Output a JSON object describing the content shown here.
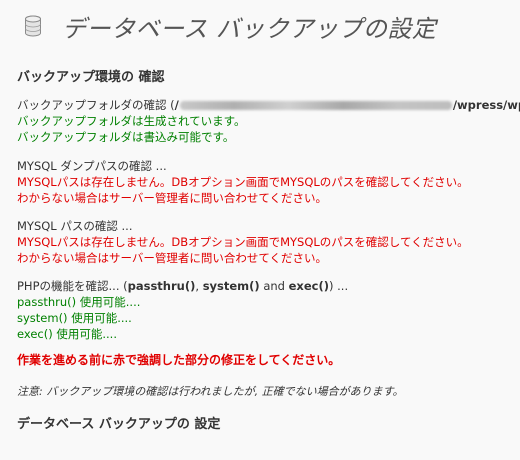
{
  "header": {
    "title": "データベース バックアップの設定",
    "icon": "database-icon"
  },
  "check_section": {
    "heading": "バックアップ環境の 確認"
  },
  "folder_check": {
    "label_prefix": "バックアップフォルダの確認 (",
    "path_start": "/",
    "path_end": "/wpress/wp-",
    "created": "バックアップフォルダは生成されています。",
    "writable": "バックアップフォルダは書込み可能です。"
  },
  "mysqldump_check": {
    "label": "MYSQL ダンプパスの確認 ...",
    "error_line1": "MYSQLパスは存在しません。DBオプション画面でMYSQLのパスを確認してください。",
    "error_line2": "わからない場合はサーバー管理者に問い合わせてください。"
  },
  "mysql_check": {
    "label": "MYSQL パスの確認 ...",
    "error_line1": "MYSQLパスは存在しません。DBオプション画面でMYSQLのパスを確認してください。",
    "error_line2": "わからない場合はサーバー管理者に問い合わせてください。"
  },
  "php_check": {
    "label_prefix": "PHPの機能を確認... (",
    "fn1": "passthru()",
    "sep1": ", ",
    "fn2": "system()",
    "sep2": " and ",
    "fn3": "exec()",
    "label_suffix": ") ...",
    "passthru": "passthru() 使用可能....",
    "system": "system() 使用可能....",
    "exec": "exec() 使用可能...."
  },
  "warning": "作業を進める前に赤で強調した部分の修正をしてください。",
  "note": "注意: バックアップ環境の確認は行われましたが, 正確でない場合があります。",
  "settings_section": {
    "heading": "データベース バックアップの 設定"
  },
  "colors": {
    "ok": "#008000",
    "error": "#e00000",
    "text": "#333333",
    "background": "#f9f9f9"
  }
}
